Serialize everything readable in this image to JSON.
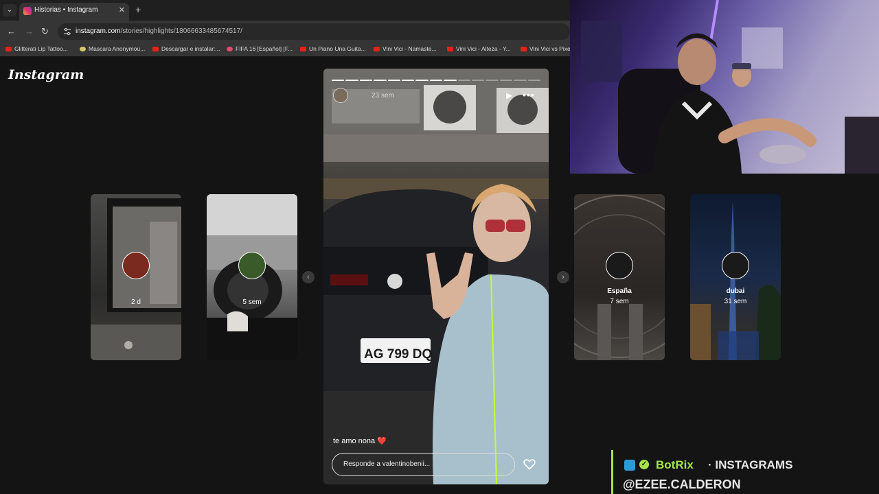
{
  "browser": {
    "tab_title": "Historias • Instagram",
    "url_host": "instagram.com",
    "url_path": "/stories/highlights/18066633485674517/",
    "bookmarks": [
      {
        "label": "Glitterati Lip Tattoo...",
        "icon": "youtube-icon"
      },
      {
        "label": "Mascara Anonymou...",
        "icon": "mask-icon"
      },
      {
        "label": "Descargar e instalar:...",
        "icon": "youtube-icon"
      },
      {
        "label": "FIFA 16 [Español] [F...",
        "icon": "fifa-icon"
      },
      {
        "label": "Un Piano Una Guita...",
        "icon": "youtube-icon"
      },
      {
        "label": "Vini Vici - Namaste...",
        "icon": "youtube-icon"
      },
      {
        "label": "Vini Vici - Alteza - Y...",
        "icon": "youtube-icon"
      },
      {
        "label": "Vini Vici vs Pixe",
        "icon": "youtube-icon"
      }
    ]
  },
  "instagram": {
    "logo": "Instagram",
    "highlights_left": [
      {
        "name": "",
        "time": "2 d"
      },
      {
        "name": "",
        "time": "5 sem"
      }
    ],
    "highlights_right": [
      {
        "name": "España",
        "time": "7 sem"
      },
      {
        "name": "dubai",
        "time": "31 sem"
      }
    ],
    "story": {
      "time": "23 sem",
      "caption": "te amo nona ❤️",
      "plate": "AG 799 DQ",
      "reply_placeholder": "Responde a valentinobenii...",
      "progress_total": 15,
      "progress_done": 9
    }
  },
  "overlay": {
    "bot_name": "BotRix",
    "separator": "·",
    "title": "INSTAGRAMS",
    "handle": "@EZEE.CALDERON",
    "accent": "#a6e34b"
  }
}
